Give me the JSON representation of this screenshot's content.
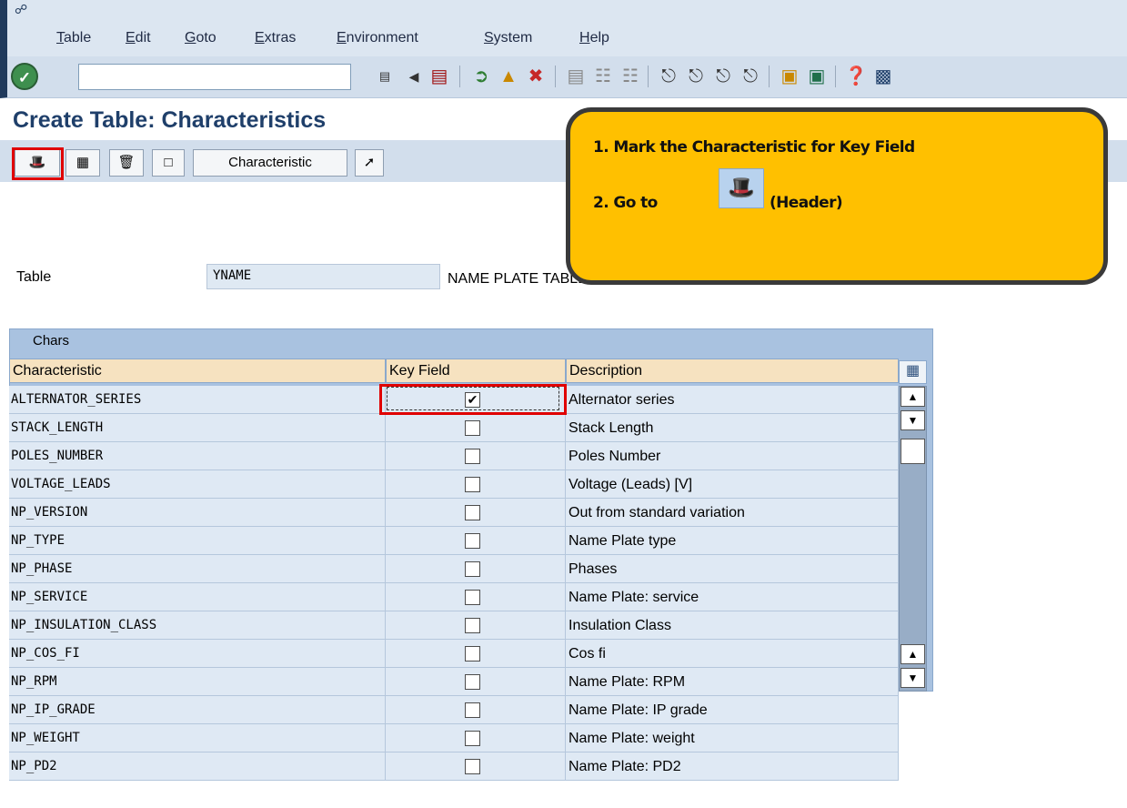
{
  "menu": {
    "items": [
      "Table",
      "Edit",
      "Goto",
      "Extras",
      "Environment",
      "System",
      "Help"
    ]
  },
  "toolbar": {
    "command_value": "",
    "icons": [
      "enter-icon",
      "command-dropdown-icon",
      "back-arrow-icon",
      "save-icon",
      "back-icon",
      "exit-icon",
      "cancel-icon",
      "print-icon",
      "find-icon",
      "find-next-icon",
      "first-page-icon",
      "previous-page-icon",
      "next-page-icon",
      "last-page-icon",
      "create-session-icon",
      "shortcut-icon",
      "help-icon",
      "layout-menu-icon"
    ]
  },
  "page": {
    "title": "Create Table: Characteristics"
  },
  "app_toolbar": {
    "characteristic_label": "Characteristic"
  },
  "table_field": {
    "label": "Table",
    "value": "YNAME",
    "description": "NAME PLATE TABLE"
  },
  "callout": {
    "step1": "1. Mark the Characteristic for Key Field",
    "step2_prefix": "2. Go to",
    "step2_suffix": "(Header)"
  },
  "grid": {
    "caption": "Chars",
    "columns": [
      "Characteristic",
      "Key Field",
      "Description"
    ],
    "rows": [
      {
        "characteristic": "ALTERNATOR_SERIES",
        "key_field": true,
        "description": "Alternator series"
      },
      {
        "characteristic": "STACK_LENGTH",
        "key_field": false,
        "description": "Stack Length"
      },
      {
        "characteristic": "POLES_NUMBER",
        "key_field": false,
        "description": "Poles Number"
      },
      {
        "characteristic": "VOLTAGE_LEADS",
        "key_field": false,
        "description": "Voltage (Leads) [V]"
      },
      {
        "characteristic": "NP_VERSION",
        "key_field": false,
        "description": "Out from standard variation"
      },
      {
        "characteristic": "NP_TYPE",
        "key_field": false,
        "description": "Name Plate type"
      },
      {
        "characteristic": "NP_PHASE",
        "key_field": false,
        "description": "Phases"
      },
      {
        "characteristic": "NP_SERVICE",
        "key_field": false,
        "description": "Name Plate: service"
      },
      {
        "characteristic": "NP_INSULATION_CLASS",
        "key_field": false,
        "description": "Insulation Class"
      },
      {
        "characteristic": "NP_COS_FI",
        "key_field": false,
        "description": "Cos fi"
      },
      {
        "characteristic": "NP_RPM",
        "key_field": false,
        "description": "Name Plate: RPM"
      },
      {
        "characteristic": "NP_IP_GRADE",
        "key_field": false,
        "description": "Name Plate: IP grade"
      },
      {
        "characteristic": "NP_WEIGHT",
        "key_field": false,
        "description": "Name Plate: weight"
      },
      {
        "characteristic": "NP_PD2",
        "key_field": false,
        "description": "Name Plate: PD2"
      }
    ]
  },
  "colors": {
    "title": "#1f3f6a",
    "callout": "#ffc000",
    "highlight": "#e00000",
    "grid_header": "#f6e2c0"
  }
}
